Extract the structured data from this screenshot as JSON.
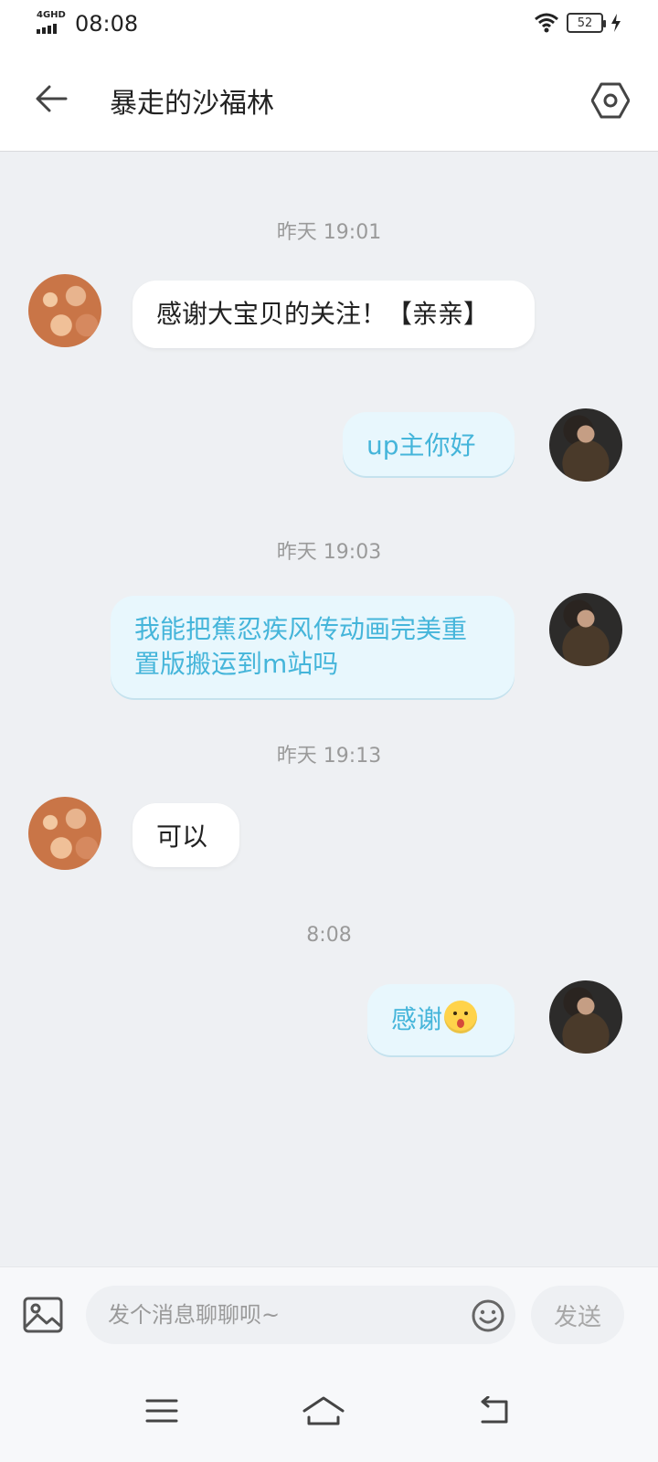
{
  "status_bar": {
    "network": "4GHD",
    "time": "08:08",
    "battery": "52"
  },
  "header": {
    "title": "暴走的沙福林"
  },
  "messages": [
    {
      "kind": "timestamp",
      "text": "昨天 19:01"
    },
    {
      "kind": "incoming",
      "text": "感谢大宝贝的关注！【亲亲】"
    },
    {
      "kind": "outgoing",
      "text": "up主你好"
    },
    {
      "kind": "timestamp",
      "text": "昨天 19:03"
    },
    {
      "kind": "outgoing",
      "text": "我能把蕉忍疾风传动画完美重置版搬运到m站吗"
    },
    {
      "kind": "timestamp",
      "text": "昨天 19:13"
    },
    {
      "kind": "incoming",
      "text": "可以"
    },
    {
      "kind": "timestamp",
      "text": "8:08"
    },
    {
      "kind": "outgoing",
      "text": "感谢"
    }
  ],
  "input": {
    "placeholder": "发个消息聊聊呗~",
    "value": ""
  },
  "send_label": "发送",
  "icons": {
    "back": "arrow-left-icon",
    "settings": "hexagon-settings-icon",
    "image": "image-icon",
    "emoji": "smiley-icon",
    "nav_menu": "menu-icon",
    "nav_home": "home-icon",
    "nav_back": "back-icon"
  },
  "colors": {
    "outgoing_text": "#45b5da",
    "outgoing_bg": "#e8f7fd",
    "background": "#eef0f3"
  }
}
